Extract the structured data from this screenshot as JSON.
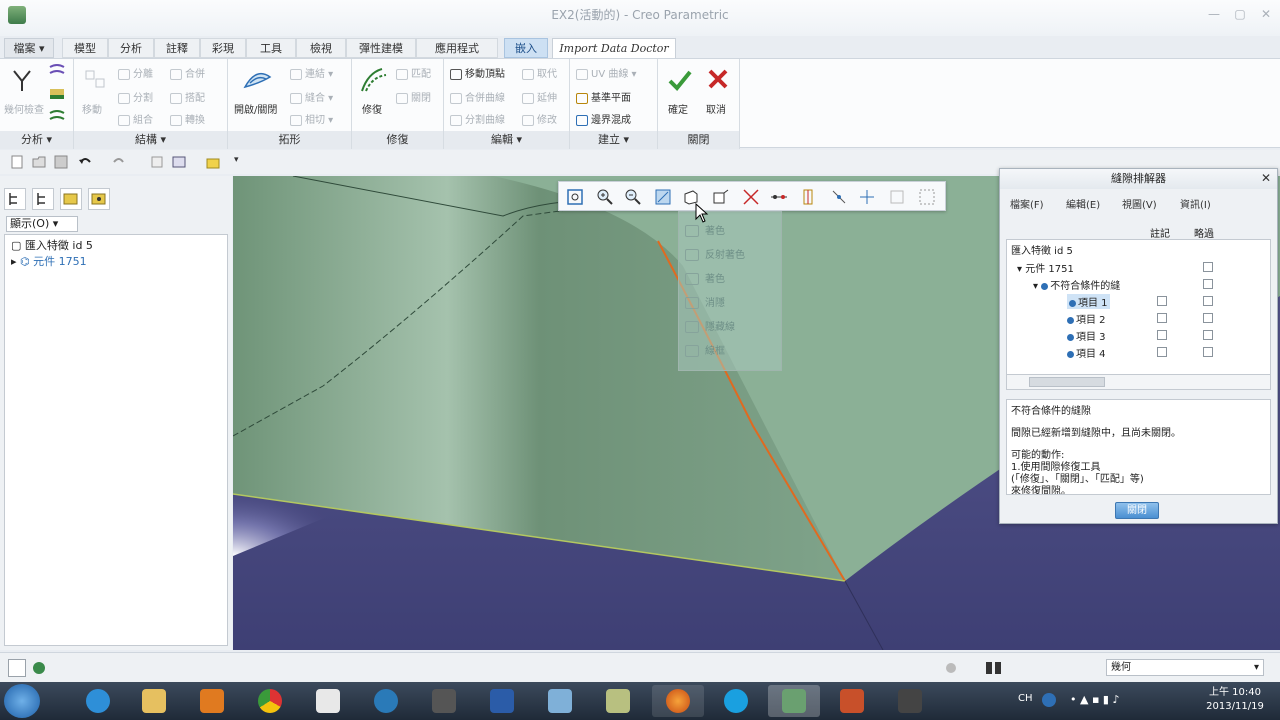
{
  "window": {
    "title": "EX2(活動的) - Creo Parametric",
    "minimize": "—",
    "maximize": "▢",
    "close": "✕"
  },
  "tabs": [
    {
      "label": "檔案 ▾"
    },
    {
      "label": "模型"
    },
    {
      "label": "分析"
    },
    {
      "label": "註釋"
    },
    {
      "label": "彩現"
    },
    {
      "label": "工具"
    },
    {
      "label": "檢視"
    },
    {
      "label": "彈性建模"
    },
    {
      "label": "應用程式"
    },
    {
      "label": "嵌入"
    },
    {
      "label": "Import Data Doctor"
    }
  ],
  "ribbon": {
    "groups": [
      {
        "label": "分析 ▾"
      },
      {
        "label": "結構 ▾"
      },
      {
        "label": "拓形"
      },
      {
        "label": "修復"
      },
      {
        "label": "編輯 ▾"
      },
      {
        "label": "建立 ▾"
      },
      {
        "label": "關閉"
      }
    ],
    "analysis": {
      "big": "幾何檢查"
    },
    "structure": {
      "big": "移動",
      "items": [
        "分離",
        "合併",
        "分割",
        "搭配",
        "組合",
        "轉換"
      ]
    },
    "topology": {
      "big": "開啟/關閉",
      "items": [
        "連結",
        "縫合",
        "相切"
      ]
    },
    "repair": {
      "big": "修復",
      "items": [
        "匹配",
        "關閉"
      ]
    },
    "edit": {
      "items": [
        "移動頂點",
        "取代",
        "合併曲線",
        "延伸",
        "分割曲線",
        "修改"
      ]
    },
    "create": {
      "items": [
        "UV 曲線",
        "基準平面",
        "邊界混成"
      ]
    },
    "close": {
      "ok": "確定",
      "cancel": "取消"
    }
  },
  "leftpanel": {
    "show_label": "顯示(O)  ▾",
    "tree": [
      {
        "label": "匯入特徵 id 5"
      },
      {
        "label": "元件 1751"
      }
    ]
  },
  "view_dropdown": {
    "items": [
      "著色",
      "反射著色",
      "著色",
      "消隱",
      "隱藏線",
      "線框"
    ]
  },
  "dialog": {
    "title": "縫隙排解器",
    "menu": [
      "檔案(F)",
      "編輯(E)",
      "視圖(V)",
      "資訊(I)"
    ],
    "columns": [
      "註記",
      "略過"
    ],
    "tree": [
      {
        "label": "匯入特徵 id 5"
      },
      {
        "label": "元件 1751"
      },
      {
        "label": "不符合條件的縫"
      },
      {
        "label": "項目 1"
      },
      {
        "label": "項目 2"
      },
      {
        "label": "項目 3"
      },
      {
        "label": "項目 4"
      }
    ],
    "info": [
      "不符合條件的縫隙",
      "間隙已經新增到縫隙中，且尚未關閉。",
      "可能的動作:",
      "1.使用間隙修復工具",
      "(「修復」、「關閉」、「匹配」等)",
      "來修復間隙。"
    ],
    "close_button": "關閉"
  },
  "statusbar": {
    "filter": "幾何"
  },
  "taskbar": {
    "lang": "CH",
    "time": "上午 10:40",
    "date": "2013/11/19"
  },
  "colors": {
    "viewport_bg": "#4b4c84",
    "surface": "#7fa38a",
    "accent_blue": "#2e6fb5",
    "ok_green": "#3a9a3a",
    "cancel_red": "#c62828",
    "highlight_edge": "#e06a20"
  }
}
